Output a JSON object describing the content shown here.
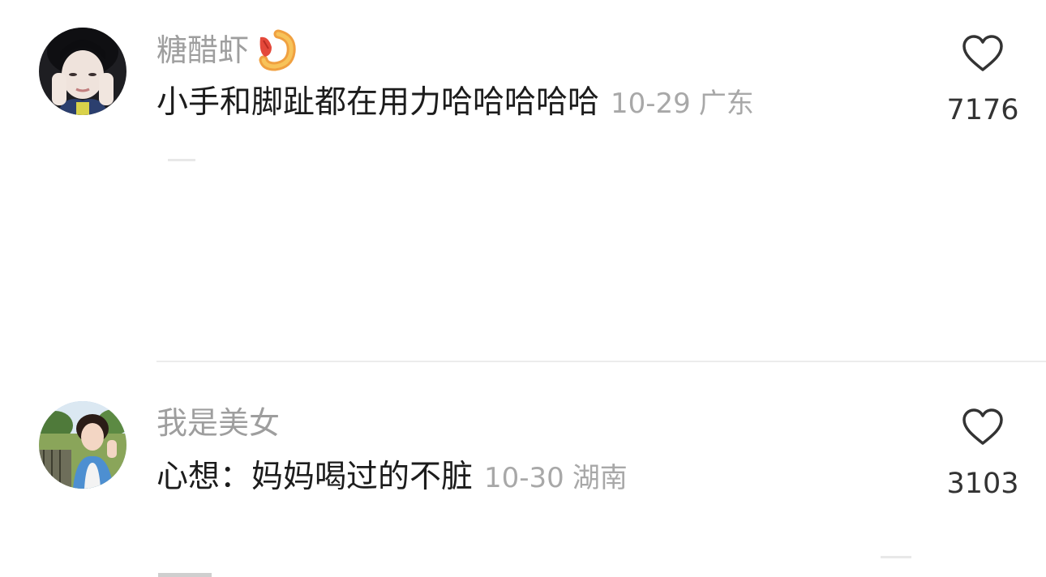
{
  "comments": [
    {
      "username": "糖醋虾",
      "username_emoji": "shrimp-emoji",
      "text": "小手和脚趾都在用力哈哈哈哈哈",
      "date": "10-29",
      "location": "广东",
      "likes": "7176",
      "like_icon": "heart-outline-icon"
    },
    {
      "username": "我是美女",
      "text": "心想：妈妈喝过的不脏",
      "date": "10-30",
      "location": "湖南",
      "likes": "3103",
      "like_icon": "heart-outline-icon"
    }
  ],
  "colors": {
    "username": "#9e9e9e",
    "text": "#1c1c1c",
    "meta": "#a8a8a8",
    "count": "#333333",
    "divider": "#ececec"
  }
}
